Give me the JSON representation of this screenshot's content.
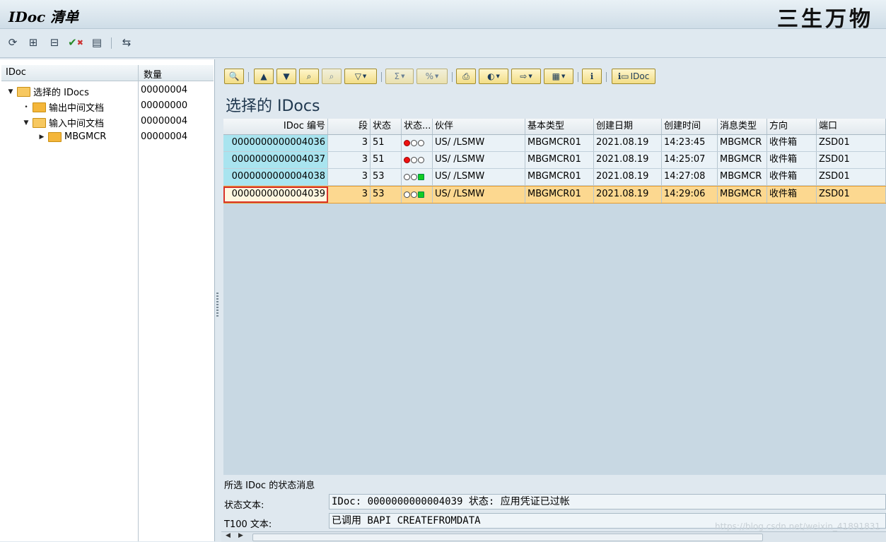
{
  "window": {
    "title": "IDoc 清单",
    "watermark": "三生万物"
  },
  "toolbar": {
    "icons": [
      "refresh-icon",
      "expand-icon",
      "collapse-icon",
      "select-delete-icon",
      "document-icon",
      "transfer-icon"
    ]
  },
  "tree": {
    "headers": {
      "col1": "IDoc",
      "col2": "数量"
    },
    "rows": [
      {
        "label": "选择的 IDocs",
        "count": "00000004"
      },
      {
        "label": "输出中间文档",
        "count": "00000000"
      },
      {
        "label": "输入中间文档",
        "count": "00000004"
      },
      {
        "label": "MBGMCR",
        "count": "00000004"
      }
    ]
  },
  "alv": {
    "section_title": "选择的 IDocs",
    "idoc_button": "IDoc",
    "columns": [
      "IDoc 编号",
      "段",
      "状态",
      "状态...",
      "伙伴",
      "基本类型",
      "创建日期",
      "创建时间",
      "消息类型",
      "方向",
      "端口"
    ],
    "rows": [
      {
        "idoc": "0000000000004036",
        "seg": "3",
        "status": "51",
        "light": "red",
        "partner": "US/  /LSMW",
        "basetype": "MBGMCR01",
        "date": "2021.08.19",
        "time": "14:23:45",
        "msgtype": "MBGMCR",
        "direction": "收件箱",
        "port": "ZSD01"
      },
      {
        "idoc": "0000000000004037",
        "seg": "3",
        "status": "51",
        "light": "red",
        "partner": "US/  /LSMW",
        "basetype": "MBGMCR01",
        "date": "2021.08.19",
        "time": "14:25:07",
        "msgtype": "MBGMCR",
        "direction": "收件箱",
        "port": "ZSD01"
      },
      {
        "idoc": "0000000000004038",
        "seg": "3",
        "status": "53",
        "light": "green",
        "partner": "US/  /LSMW",
        "basetype": "MBGMCR01",
        "date": "2021.08.19",
        "time": "14:27:08",
        "msgtype": "MBGMCR",
        "direction": "收件箱",
        "port": "ZSD01"
      },
      {
        "idoc": "0000000000004039",
        "seg": "3",
        "status": "53",
        "light": "green",
        "partner": "US/  /LSMW",
        "basetype": "MBGMCR01",
        "date": "2021.08.19",
        "time": "14:29:06",
        "msgtype": "MBGMCR",
        "direction": "收件箱",
        "port": "ZSD01"
      }
    ]
  },
  "status_panel": {
    "title": "所选 IDoc 的状态消息",
    "status_label": "状态文本:",
    "status_value": "IDoc: 0000000000004039 状态: 应用凭证已过帐",
    "t100_label": "T100 文本:",
    "t100_value": "已调用 BAPI CREATEFROMDATA"
  },
  "footer_watermark": "https://blog.csdn.net/weixin_41891831"
}
